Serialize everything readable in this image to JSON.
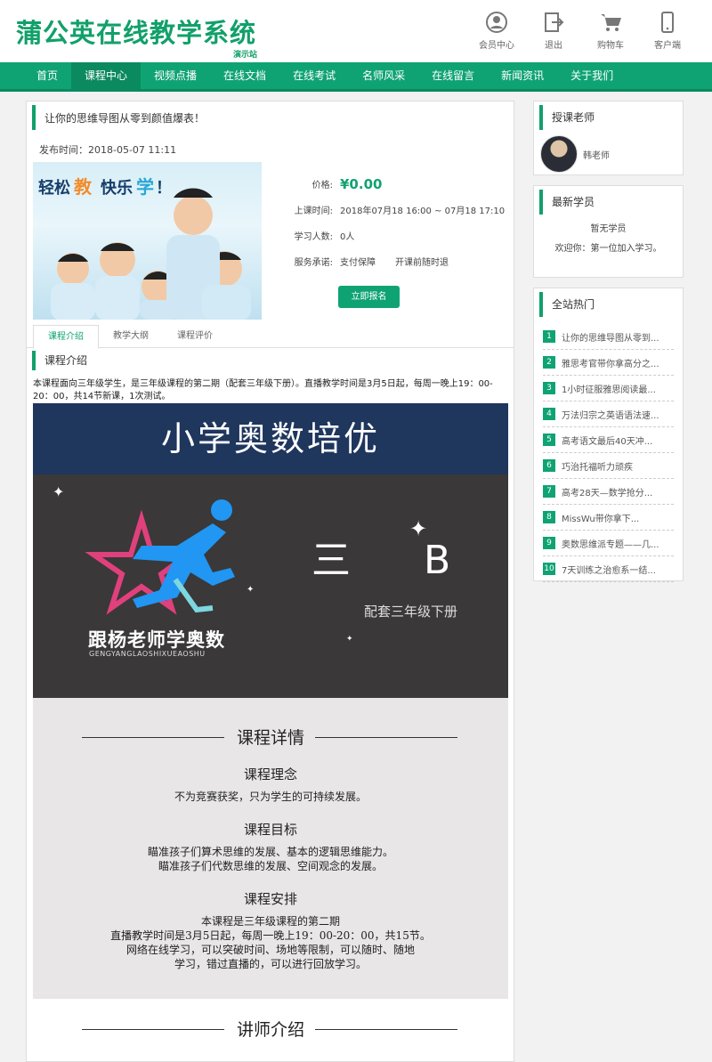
{
  "header": {
    "logo": "蒲公英在线教学系统",
    "logo_sub": "演示站",
    "links": [
      {
        "label": "会员中心",
        "icon": "user-icon"
      },
      {
        "label": "退出",
        "icon": "logout-icon"
      },
      {
        "label": "购物车",
        "icon": "cart-icon"
      },
      {
        "label": "客户端",
        "icon": "mobile-icon"
      }
    ]
  },
  "nav": [
    "首页",
    "课程中心",
    "视频点播",
    "在线文档",
    "在线考试",
    "名师风采",
    "在线留言",
    "新闻资讯",
    "关于我们"
  ],
  "course": {
    "title": "让你的思维导图从零到颜值爆表！",
    "published": "发布时间：2018-05-07 11:11",
    "image_text": [
      "轻松",
      "教",
      "快乐",
      "学",
      "！"
    ],
    "price_label": "价格:",
    "price": "¥0.00",
    "time_label": "上课时间:",
    "time": "2018年07月18 16:00 ~ 07月18 17:10",
    "students_label": "学习人数:",
    "students": "0人",
    "promise_label": "服务承诺:",
    "promise": [
      "支付保障",
      "开课前随时退"
    ],
    "signup": "立即报名"
  },
  "tabs": [
    "课程介绍",
    "教学大纲",
    "课程评价"
  ],
  "intro": {
    "heading": "课程介绍",
    "text": "本课程面向三年级学生，是三年级课程的第二期（配套三年级下册）。直播教学时间是3月5日起，每周一晚上19：00-20：00，共14节新课，1次测试。"
  },
  "poster": {
    "title": "小学奥数培优",
    "brand_cn": "跟杨老师学奥数",
    "brand_py": "GENGYANGLAOSHIXUEAOSHU",
    "grade": "三 B",
    "grade_sub": "配套三年级下册"
  },
  "detail": {
    "heading": "课程详情",
    "sections": [
      {
        "h": "课程理念",
        "lines": [
          "不为竞赛获奖，只为学生的可持续发展。"
        ]
      },
      {
        "h": "课程目标",
        "lines": [
          "瞄准孩子们算术思维的发展、基本的逻辑思维能力。",
          "瞄准孩子们代数思维的发展、空间观念的发展。"
        ]
      },
      {
        "h": "课程安排",
        "lines": [
          "本课程是三年级课程的第二期",
          "直播教学时间是3月5日起，每周一晚上19：00-20：00，共15节。",
          "网络在线学习，可以突破时间、场地等限制，可以随时、随地",
          "学习，错过直播的，可以进行回放学习。"
        ]
      }
    ],
    "teacher_heading": "讲师介绍"
  },
  "sidebar": {
    "teacher_title": "授课老师",
    "teacher_name": "韩老师",
    "students_title": "最新学员",
    "no_students": "暂无学员",
    "welcome": "欢迎你：第一位加入学习。",
    "hot_title": "全站热门",
    "hot": [
      "让你的思维导图从零到...",
      "雅思考官带你拿高分之...",
      "1小时征服雅思阅读最...",
      "万法归宗之英语语法速...",
      "高考语文最后40天冲...",
      "巧治托福听力顽疾",
      "高考28天—数学抢分...",
      "MissWu带你拿下...",
      "奥数思维派专题——几...",
      "7天训练之治愈系一结..."
    ]
  },
  "colors": {
    "accent": "#0fa373",
    "poster_top": "#1f365d",
    "poster_body": "#3a3838"
  }
}
